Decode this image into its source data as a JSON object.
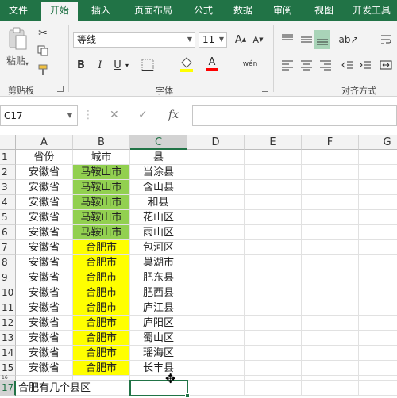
{
  "ribbon_tabs": [
    "文件",
    "开始",
    "插入",
    "页面布局",
    "公式",
    "数据",
    "审阅",
    "视图",
    "开发工具"
  ],
  "ribbon": {
    "clipboard": {
      "paste_label": "粘贴",
      "group_label": "剪贴板"
    },
    "font": {
      "font_name": "等线",
      "font_size": "11",
      "bold": "B",
      "italic": "I",
      "underline": "U",
      "font_color_glyph": "A",
      "phonetic_glyph": "wén",
      "group_label": "字体",
      "fill_color": "#ffff00",
      "font_color": "#ff0000"
    },
    "alignment": {
      "group_label": "对齐方式"
    }
  },
  "formula_bar": {
    "name_box": "C17",
    "fx": "fx",
    "formula": ""
  },
  "grid": {
    "columns": [
      "A",
      "B",
      "C",
      "D",
      "E",
      "F",
      "G"
    ],
    "row_numbers": [
      "1",
      "2",
      "3",
      "4",
      "5",
      "6",
      "7",
      "8",
      "9",
      "10",
      "11",
      "12",
      "13",
      "14",
      "15",
      "16",
      "17"
    ],
    "header_row": [
      "省份",
      "城市",
      "县"
    ],
    "rows": [
      [
        "安徽省",
        "马鞍山市",
        "当涂县"
      ],
      [
        "安徽省",
        "马鞍山市",
        "含山县"
      ],
      [
        "安徽省",
        "马鞍山市",
        "和县"
      ],
      [
        "安徽省",
        "马鞍山市",
        "花山区"
      ],
      [
        "安徽省",
        "马鞍山市",
        "雨山区"
      ],
      [
        "安徽省",
        "合肥市",
        "包河区"
      ],
      [
        "安徽省",
        "合肥市",
        "巢湖市"
      ],
      [
        "安徽省",
        "合肥市",
        "肥东县"
      ],
      [
        "安徽省",
        "合肥市",
        "肥西县"
      ],
      [
        "安徽省",
        "合肥市",
        "庐江县"
      ],
      [
        "安徽省",
        "合肥市",
        "庐阳区"
      ],
      [
        "安徽省",
        "合肥市",
        "蜀山区"
      ],
      [
        "安徽省",
        "合肥市",
        "瑶海区"
      ],
      [
        "安徽省",
        "合肥市",
        "长丰县"
      ]
    ],
    "row17_a": "合肥有几个县区",
    "selected_cell": "C17",
    "colors": {
      "green": "#92d050",
      "yellow": "#ffff00",
      "accent": "#217346"
    }
  }
}
